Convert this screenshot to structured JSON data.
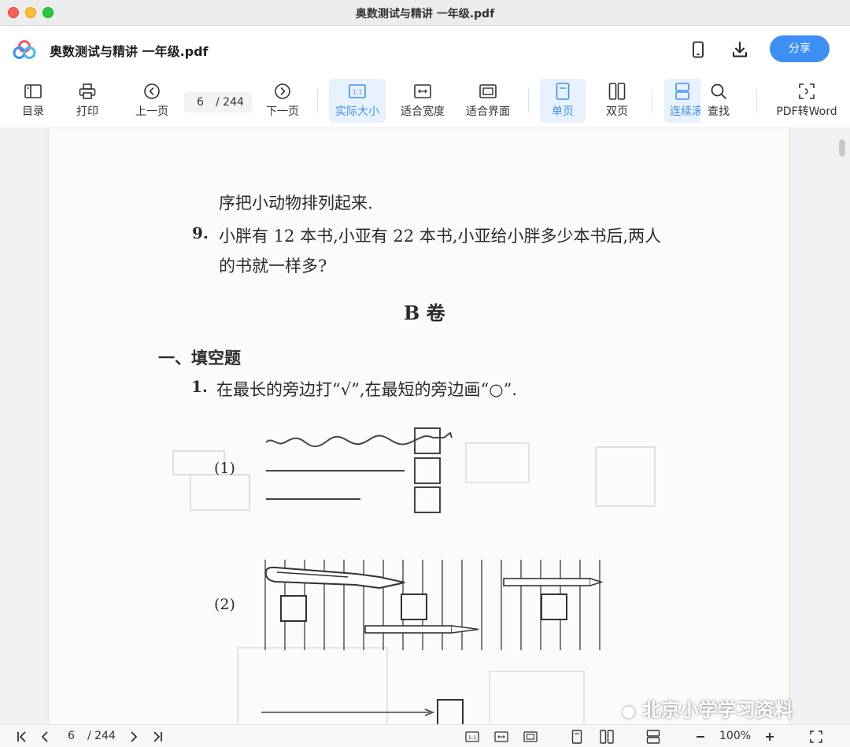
{
  "window": {
    "title": "奥数测试与精讲 一年级.pdf"
  },
  "header": {
    "doc_title": "奥数测试与精讲 一年级.pdf",
    "share_label": "分享",
    "accent_color": "#3d8ff5"
  },
  "toolbar": {
    "toc": "目录",
    "print": "打印",
    "prev": "上一页",
    "page_current": "6",
    "page_total": "/ 244",
    "next": "下一页",
    "actual_size": "实际大小",
    "fit_width": "适合宽度",
    "fit_page": "适合界面",
    "single": "单页",
    "double": "双页",
    "continuous": "连续滚",
    "find": "查找",
    "pdf_to_word": "PDF转Word"
  },
  "document": {
    "line1": "序把小动物排列起来.",
    "q9_num": "9.",
    "q9_line1": "小胖有 12 本书,小亚有 22 本书,小亚给小胖多少本书后,两人",
    "q9_line2": "的书就一样多?",
    "section_title": "B  卷",
    "part_heading": "一、填空题",
    "q1_num": "1.",
    "q1_text": "在最长的旁边打“√”,在最短的旁边画“○”.",
    "sub1": "(1)",
    "sub2": "(2)"
  },
  "statusbar": {
    "page_current": "6",
    "page_total": "/ 244",
    "zoom": "100%"
  },
  "watermark": "北京小学学习资料"
}
